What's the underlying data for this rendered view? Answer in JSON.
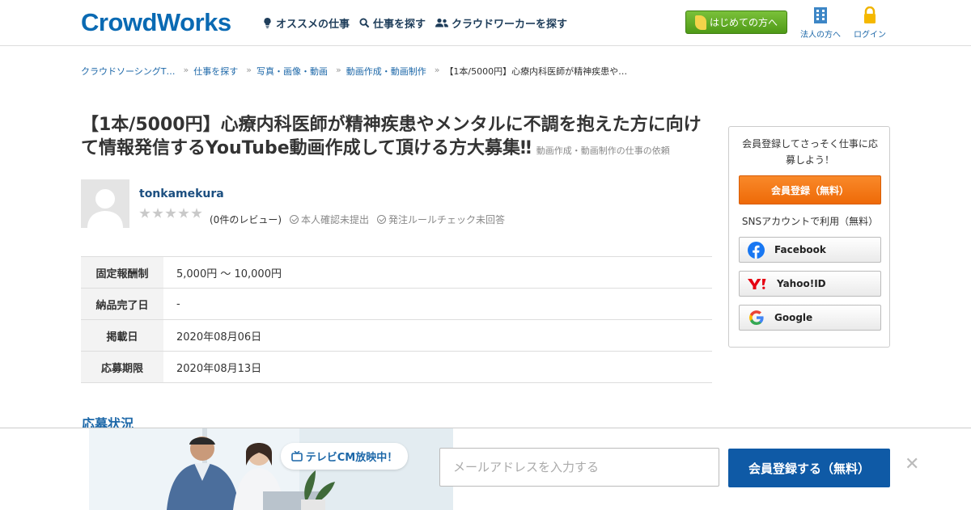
{
  "header": {
    "logo": "CrowdWorks",
    "nav": [
      {
        "label": "オススメの仕事",
        "icon": "bulb-icon"
      },
      {
        "label": "仕事を探す",
        "icon": "search-icon"
      },
      {
        "label": "クラウドワーカーを探す",
        "icon": "people-icon"
      }
    ],
    "first_time_label": "はじめての方へ",
    "corporate_label": "法人の方へ",
    "login_label": "ログイン"
  },
  "breadcrumb": [
    "クラウドソーシングT…",
    "仕事を探す",
    "写真・画像・動画",
    "動画作成・動画制作",
    "【1本/5000円】心療内科医師が精神疾患や…"
  ],
  "job": {
    "title": "【1本/5000円】心療内科医師が精神疾患やメンタルに不調を抱えた方に向けて情報発信するYouTube動画作成して頂ける方大募集‼",
    "category_suffix": "動画作成・動画制作の仕事の依頼"
  },
  "client": {
    "name": "tonkamekura",
    "rating_stars": 0,
    "reviews": "(0件のレビュー)",
    "identity": "本人確認未提出",
    "rule_check": "発注ルールチェック未回答"
  },
  "details": [
    {
      "label": "固定報酬制",
      "value": "5,000円 〜 10,000円"
    },
    {
      "label": "納品完了日",
      "value": "-"
    },
    {
      "label": "掲載日",
      "value": "2020年08月06日"
    },
    {
      "label": "応募期限",
      "value": "2020年08月13日"
    }
  ],
  "section": {
    "applicants_title": "応募状況"
  },
  "sidebar": {
    "message": "会員登録してさっそく仕事に応募しよう！",
    "register_label": "会員登録（無料）",
    "sns_label": "SNSアカウントで利用（無料）",
    "facebook_label": "Facebook",
    "yahoo_label": "Yahoo!ID",
    "google_label": "Google"
  },
  "bottom": {
    "tv_badge": "テレビCM放映中！",
    "email_placeholder": "メールアドレスを入力する",
    "submit_label": "会員登録する（無料）",
    "close": "✕"
  },
  "colors": {
    "brand_blue": "#0a6ab3",
    "green_button": "#5ba51f",
    "orange_button": "#f27a12",
    "submit_blue": "#0f5aa6"
  }
}
